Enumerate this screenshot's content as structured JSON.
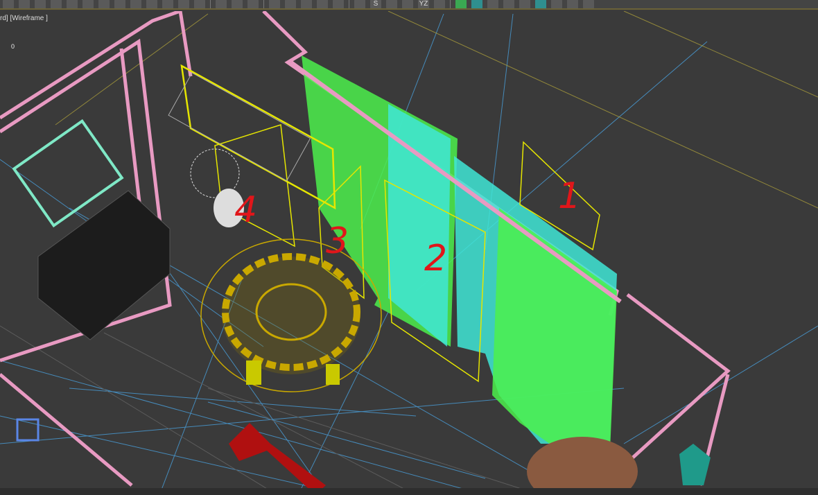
{
  "toolbar": {
    "icons": [
      "select-icon",
      "link-icon",
      "layer-icon",
      "clipboard-icon",
      "circle-icon",
      "stack-icon",
      "cloud-icon",
      "light-icon",
      "panel-icon",
      "play-icon",
      "viewport-icon",
      "sphere-icon",
      "help-icon",
      "tree-icon",
      "list-icon",
      "help-icon",
      "snap-icon",
      "move-icon",
      "material-icon",
      "eraser-icon",
      "xyz-icon",
      "render-icon",
      "s-list-icon",
      "minus-icon",
      "plus-icon",
      "yz-icon",
      "ring-icon",
      "hex-icon",
      "globe-icon",
      "brush-icon",
      "m-icon",
      "wand-icon",
      "paint-icon",
      "gear-icon",
      "edit-icon",
      "settings-icon"
    ],
    "yz_label": "YZ",
    "s_label": "S"
  },
  "viewport": {
    "label": "rd] [Wireframe ]",
    "zero": "0",
    "annotations": [
      "1",
      "2",
      "3",
      "4"
    ]
  },
  "colors": {
    "background": "#3a3a3a",
    "walls": "#e89ac2",
    "curtain_green": "#4cf04c",
    "curtain_cyan": "#3fe6d6",
    "chandelier": "#c9a800",
    "selection": "#e6e600",
    "grid": "#4aa6e6",
    "annotation": "#e0161a"
  }
}
